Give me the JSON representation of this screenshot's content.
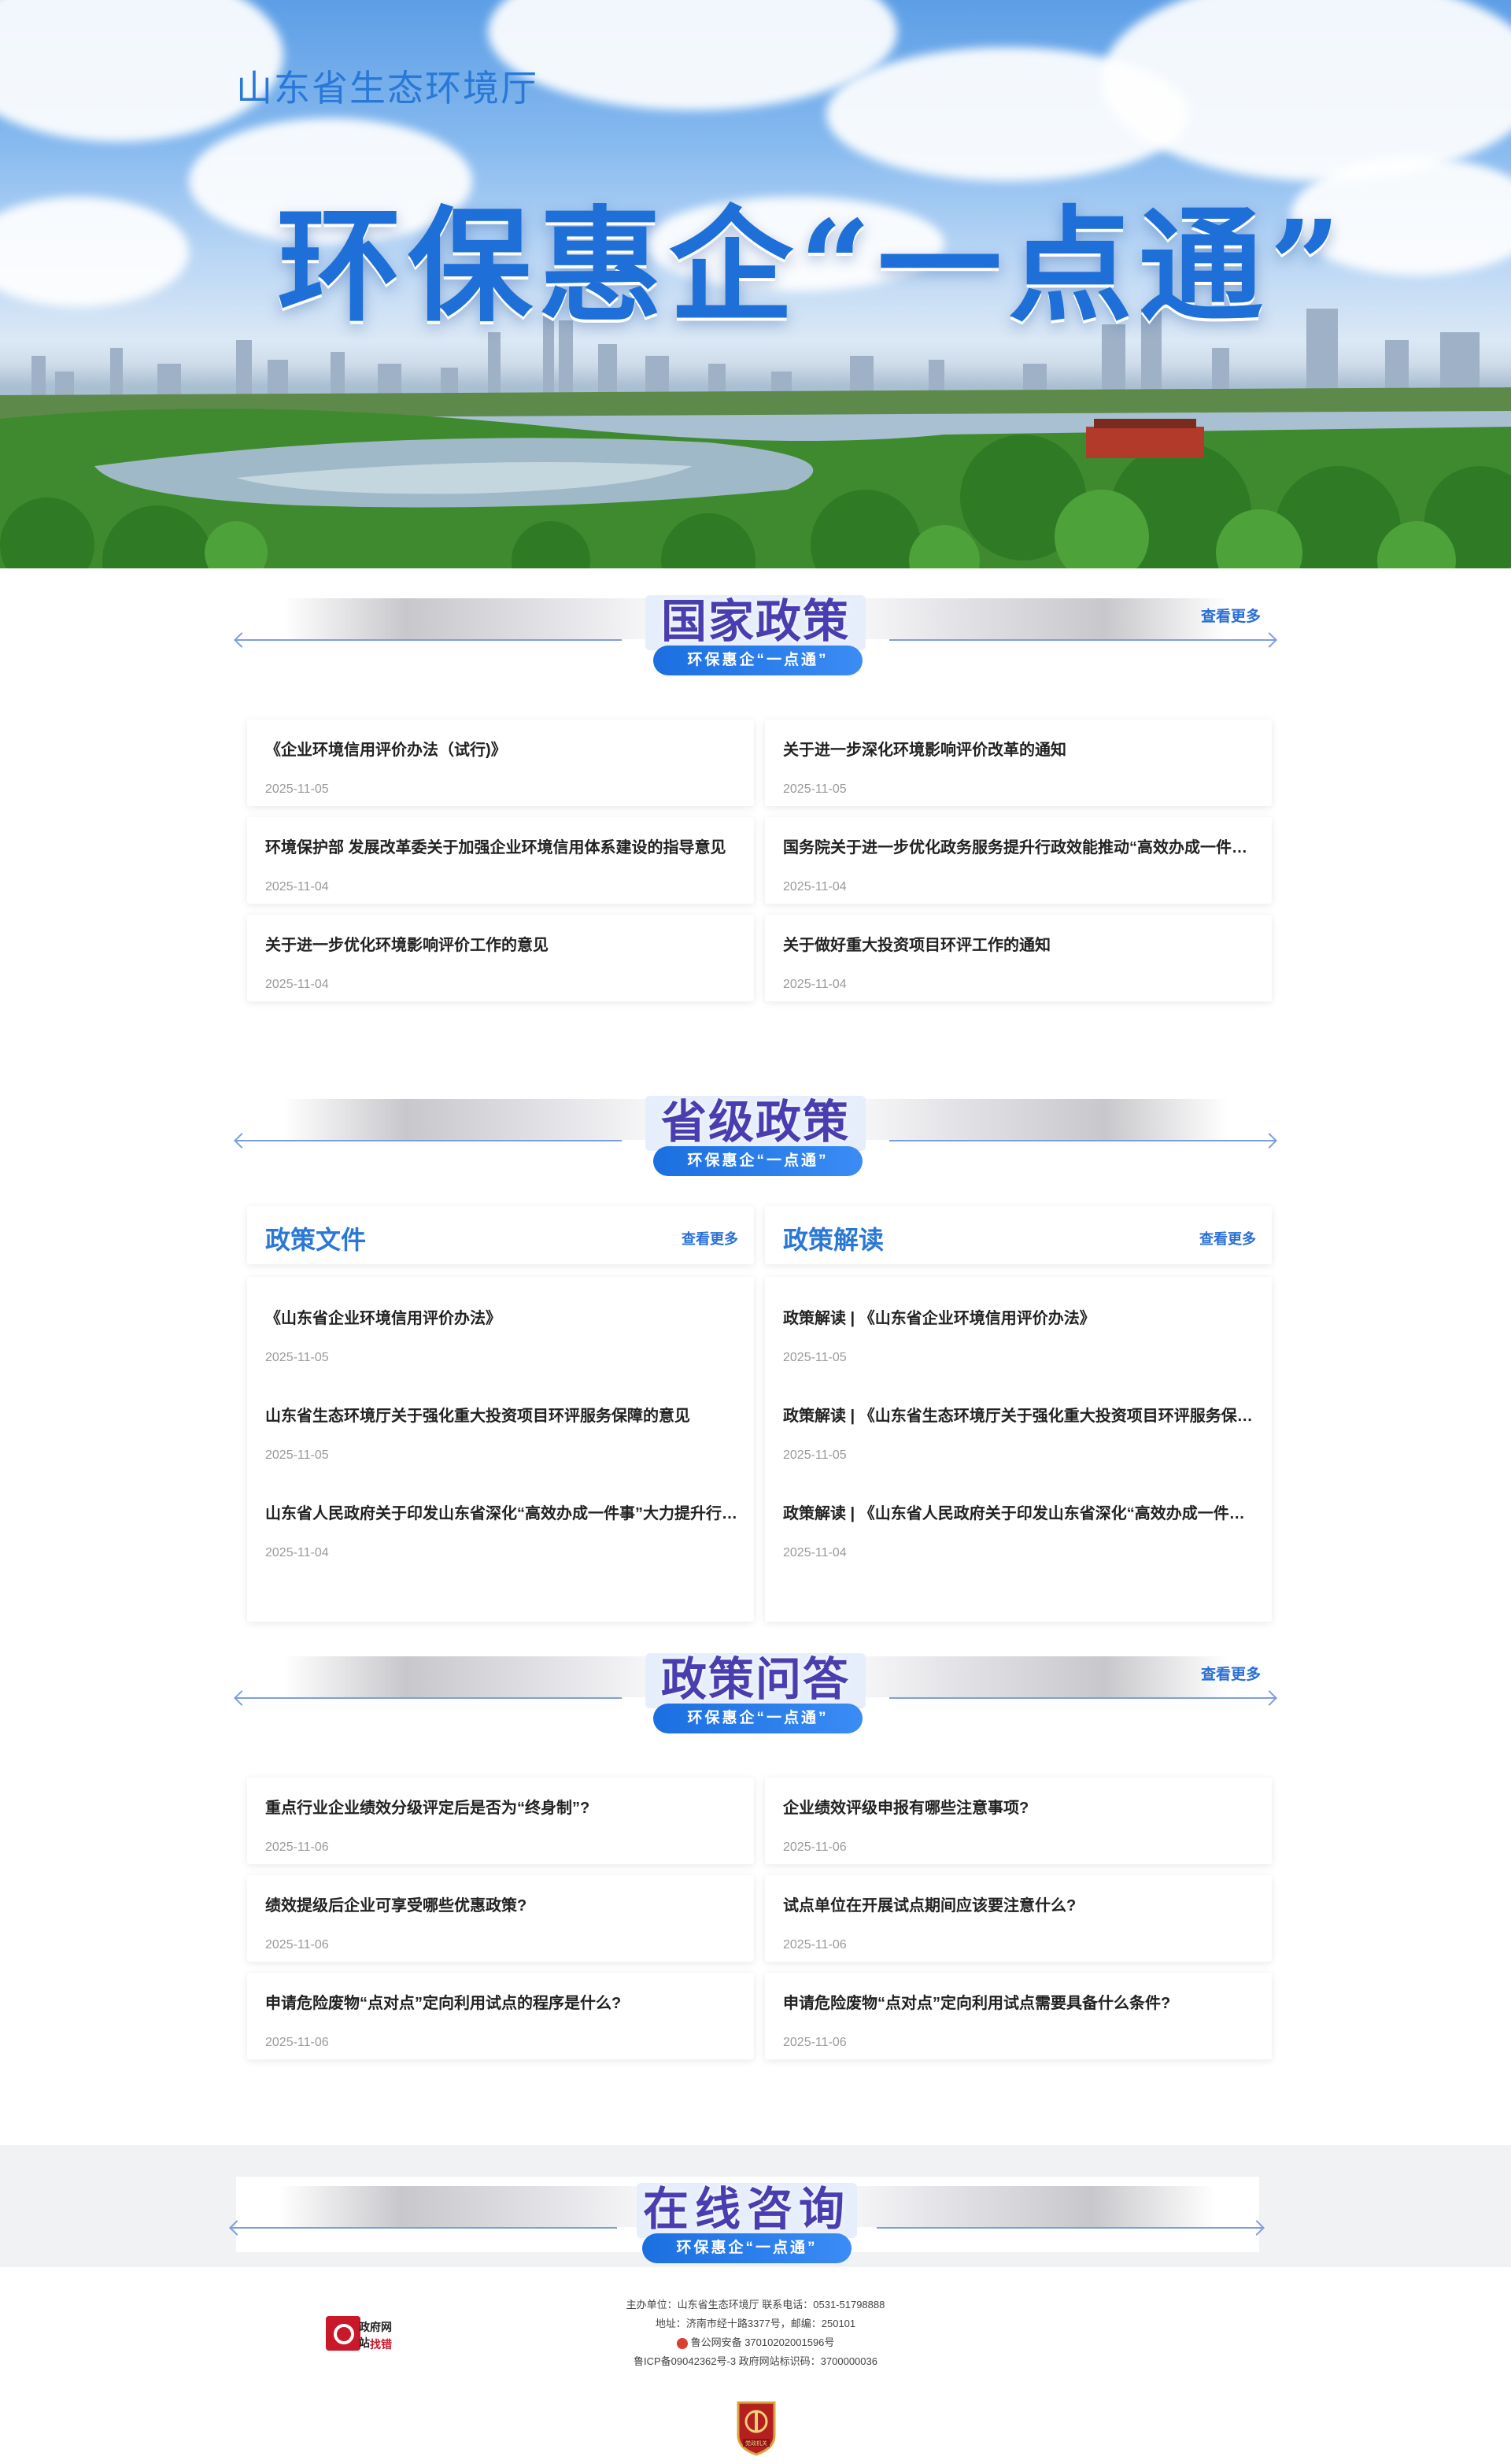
{
  "hero": {
    "org": "山东省生态环境厅",
    "title": "环保惠企“一点通”"
  },
  "sections": {
    "national": {
      "title": "国家政策",
      "subtitle": "环保惠企“一点通”",
      "more": "查看更多",
      "items": [
        {
          "title": "《企业环境信用评价办法（试行)》",
          "date": "2025-11-05"
        },
        {
          "title": "关于进一步深化环境影响评价改革的通知",
          "date": "2025-11-05"
        },
        {
          "title": "环境保护部 发展改革委关于加强企业环境信用体系建设的指导意见",
          "date": "2025-11-04"
        },
        {
          "title": "国务院关于进一步优化政务服务提升行政效能推动“高效办成一件事”指导意见",
          "date": "2025-11-04"
        },
        {
          "title": "关于进一步优化环境影响评价工作的意见",
          "date": "2025-11-04"
        },
        {
          "title": "关于做好重大投资项目环评工作的通知",
          "date": "2025-11-04"
        }
      ]
    },
    "provincial": {
      "title": "省级政策",
      "subtitle": "环保惠企“一点通”",
      "files": {
        "name": "政策文件",
        "more": "查看更多",
        "items": [
          {
            "title": "《山东省企业环境信用评价办法》",
            "date": "2025-11-05"
          },
          {
            "title": "山东省生态环境厅关于强化重大投资项目环评服务保障的意见",
            "date": "2025-11-05"
          },
          {
            "title": "山东省人民政府关于印发山东省深化“高效办成一件事”大力提升行政效能实施方案的通知",
            "date": "2025-11-04"
          }
        ]
      },
      "readings": {
        "name": "政策解读",
        "more": "查看更多",
        "items": [
          {
            "title": "政策解读 | 《山东省企业环境信用评价办法》",
            "date": "2025-11-05"
          },
          {
            "title": "政策解读 | 《山东省生态环境厅关于强化重大投资项目环评服务保障的意见》",
            "date": "2025-11-05"
          },
          {
            "title": "政策解读 | 《山东省人民政府关于印发山东省深化“高效办成一件事”大力提升行政效能实施方案的通知》",
            "date": "2025-11-04"
          }
        ]
      }
    },
    "qa": {
      "title": "政策问答",
      "subtitle": "环保惠企“一点通”",
      "more": "查看更多",
      "items": [
        {
          "title": "重点行业企业绩效分级评定后是否为“终身制”?",
          "date": "2025-11-06"
        },
        {
          "title": "企业绩效评级申报有哪些注意事项?",
          "date": "2025-11-06"
        },
        {
          "title": "绩效提级后企业可享受哪些优惠政策?",
          "date": "2025-11-06"
        },
        {
          "title": "试点单位在开展试点期间应该要注意什么?",
          "date": "2025-11-06"
        },
        {
          "title": "申请危险废物“点对点”定向利用试点的程序是什么?",
          "date": "2025-11-06"
        },
        {
          "title": "申请危险废物“点对点”定向利用试点需要具备什么条件?",
          "date": "2025-11-06"
        }
      ]
    },
    "consult": {
      "title": "在线咨询",
      "subtitle": "环保惠企“一点通”"
    }
  },
  "footer": {
    "badge_line1": "政府网站",
    "badge_line2": "找错",
    "host": "主办单位：山东省生态环境厅 联系电话：0531-51798888",
    "address": "地址：济南市经十路3377号，邮编：250101",
    "police": "鲁公网安备 37010202001596号",
    "icp": "鲁ICP备09042362号-3 政府网站标识码：3700000036",
    "emblem_text": "党政机关"
  },
  "colors": {
    "accent": "#2a78d6",
    "title_purple": "#4a3db0",
    "pill_blue": "#1b6fe0",
    "date_gray": "#9a9a9a"
  }
}
